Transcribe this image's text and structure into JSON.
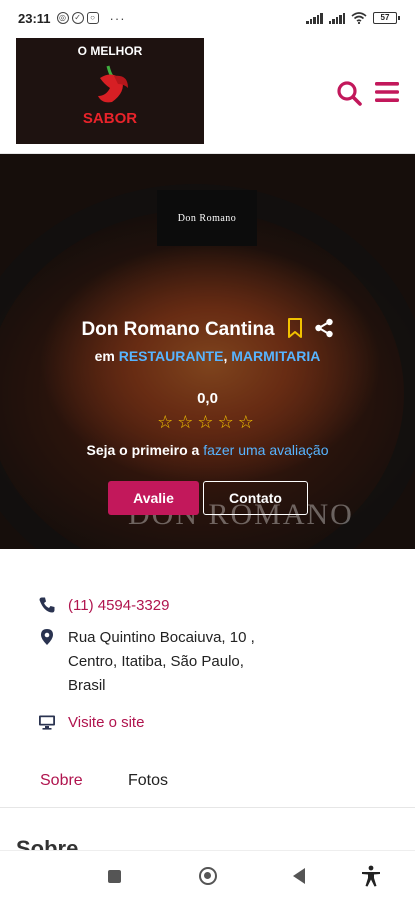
{
  "status_bar": {
    "time": "23:11",
    "notification_icons": [
      "whatsapp-icon",
      "messenger-icon",
      "instagram-icon"
    ],
    "more": "···",
    "battery": "57"
  },
  "header": {
    "logo": {
      "line1": "O MELHOR",
      "line2": "SABOR",
      "colors": {
        "background": "#1e1210",
        "text_top": "#ffffff",
        "text_bottom": "#e8232a"
      }
    },
    "icons": [
      "search-icon",
      "menu-icon"
    ],
    "accent_color": "#c2185b"
  },
  "hero": {
    "logo_text": "Don Romano",
    "title": "Don Romano Cantina",
    "category_prefix": "em",
    "categories": [
      "RESTAURANTE",
      "MARMITARIA"
    ],
    "category_separator": ",",
    "rating_value": "0,0",
    "rating_stars": 0,
    "rating_max": 5,
    "review_prompt": "Seja o primeiro a",
    "review_link": "fazer uma avaliação",
    "buttons": {
      "rate": "Avalie",
      "contact": "Contato"
    },
    "watermark": "DON ROMANO",
    "colors": {
      "category_link": "#57b4ff",
      "star": "#f2c200",
      "primary_button": "#c2185b"
    }
  },
  "info": {
    "phone": "(11) 4594-3329",
    "address_lines": [
      "Rua Quintino Bocaiuva, 10 ,",
      "Centro, Itatiba, São Paulo,",
      "Brasil"
    ],
    "website": "Visite o site",
    "link_color": "#b0144e"
  },
  "tabs": [
    {
      "label": "Sobre",
      "active": true
    },
    {
      "label": "Fotos",
      "active": false
    }
  ],
  "section": {
    "title": "Sobre"
  },
  "nav_bar": {
    "icons": [
      "recents-icon",
      "home-icon",
      "back-icon",
      "accessibility-icon"
    ]
  }
}
